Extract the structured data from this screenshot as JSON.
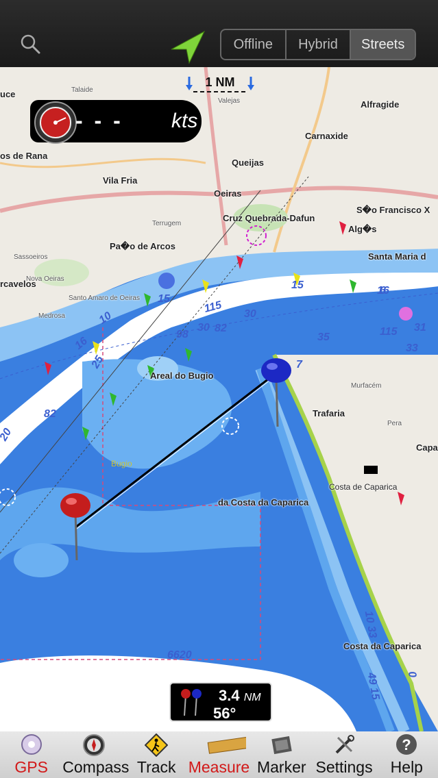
{
  "toolbar": {
    "map_modes": [
      "Offline",
      "Hybrid",
      "Streets"
    ],
    "selected_mode": "Streets"
  },
  "map": {
    "scale_label": "1 NM",
    "speed": {
      "value": "- - -",
      "unit": "kts"
    },
    "places": [
      "uce",
      "Talaide",
      "Valejas",
      "Alfragide",
      "os de Rana",
      "Carnaxide",
      "Queijas",
      "Vila Fria",
      "Oeiras",
      "S�o Francisco X",
      "Terrugem",
      "Cruz Quebrada-Dafun",
      "Alg�s",
      "Pa�o de Arcos",
      "Santa Maria d",
      "Sassoeiros",
      "rcavelos",
      "Nova Oeiras",
      "Santo Amaro de Oeiras",
      "Medrosa",
      "Areal do Bugio",
      "Trafaria",
      "Bugio",
      "Capa",
      "Costa de Caparica",
      "da Costa da Caparica",
      "Costa da Caparica",
      "Murfacém",
      "Pera"
    ],
    "depths": [
      "15",
      "16",
      "10",
      "115",
      "30",
      "98",
      "30",
      "82",
      "35",
      "115",
      "31",
      "6",
      "25",
      "82",
      "20",
      "15",
      "7",
      "33",
      "6620",
      "10 33",
      "49 15",
      "0",
      "16"
    ],
    "measure": {
      "distance": "3.4",
      "unit": "NM",
      "bearing": "56°"
    }
  },
  "tabs": [
    {
      "label": "GPS",
      "icon": "gps-icon"
    },
    {
      "label": "Compass",
      "icon": "compass-icon"
    },
    {
      "label": "Track",
      "icon": "track-icon"
    },
    {
      "label": "Measure",
      "icon": "measure-icon"
    },
    {
      "label": "Marker",
      "icon": "marker-icon"
    },
    {
      "label": "Settings",
      "icon": "settings-icon"
    },
    {
      "label": "Help",
      "icon": "help-icon"
    }
  ],
  "colors": {
    "active_tab": "#d21919",
    "deep_water": "#3a7fe0",
    "shallow_water": "#8cc3f4",
    "land": "#eeebe4",
    "channel": "#ffffff"
  }
}
